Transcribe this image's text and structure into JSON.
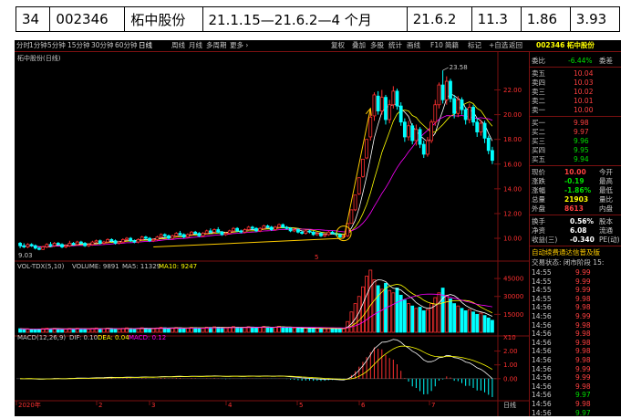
{
  "info_row": [
    "34",
    "002346",
    "柘中股份",
    "21.1.15—21.6.2—4 个月",
    "21.6.2",
    "11.3",
    "1.86",
    "3.93"
  ],
  "toolbar": {
    "periods": [
      "分时",
      "1分钟",
      "5分钟",
      "15分钟",
      "30分钟",
      "60分钟",
      "日线",
      "周线",
      "月线",
      "多周期",
      "更多 ›"
    ],
    "tools": [
      "复权",
      "叠加",
      "多股",
      "统计",
      "画线",
      "F10",
      "简籍",
      "标记",
      "+自选",
      "返回"
    ],
    "stock_code": "002346",
    "stock_name": "柘中股份"
  },
  "price_panel": {
    "label": "柘中股份(日线)",
    "high_label": "23.58",
    "low_label": "9.03",
    "marker": "5",
    "axis_ticks": [
      {
        "v": 22,
        "t": "22.00"
      },
      {
        "v": 20,
        "t": "20.00"
      },
      {
        "v": 18,
        "t": "18.00"
      },
      {
        "v": 16,
        "t": "16.00"
      },
      {
        "v": 14,
        "t": "14.00"
      },
      {
        "v": 12,
        "t": "12.00"
      },
      {
        "v": 10,
        "t": "10.00"
      }
    ]
  },
  "volume_panel": {
    "label": "VOL-TDX(5,10)",
    "vol_label": "VOLUME: 9891",
    "ma5_label": "MA5: 11329",
    "ma10_label": "MA10: 9247",
    "axis_ticks": [
      {
        "v": 45000,
        "t": "45000"
      },
      {
        "v": 30000,
        "t": "30000"
      },
      {
        "v": 15000,
        "t": "15000"
      }
    ],
    "unit": "X10"
  },
  "macd_panel": {
    "label": "MACD(12,26,9)",
    "dif_label": "DIF: 0.10",
    "dea_label": "DEA: 0.04",
    "macd_label": "MACD: 0.12",
    "axis_ticks": [
      {
        "v": 2,
        "t": "2.00"
      },
      {
        "v": 1,
        "t": "1.00"
      },
      {
        "v": 0,
        "t": "0.00"
      }
    ]
  },
  "x_axis": {
    "labels": [
      "2020年",
      "2",
      "3",
      "4",
      "5",
      "6",
      "7"
    ],
    "right_label": "日线"
  },
  "right_panel": {
    "header_code": "002346",
    "header_name": "柘中股份",
    "weibi": {
      "label": "委比",
      "value": "-6.44%",
      "label2": "委差"
    },
    "asks": [
      {
        "label": "卖五",
        "price": "10.04"
      },
      {
        "label": "卖四",
        "price": "10.03"
      },
      {
        "label": "卖三",
        "price": "10.02"
      },
      {
        "label": "卖二",
        "price": "10.01"
      },
      {
        "label": "卖一",
        "price": "10.00"
      }
    ],
    "bids": [
      {
        "label": "买一",
        "price": "9.98"
      },
      {
        "label": "买二",
        "price": "9.97"
      },
      {
        "label": "买三",
        "price": "9.96"
      },
      {
        "label": "买四",
        "price": "9.95"
      },
      {
        "label": "买五",
        "price": "9.94"
      }
    ],
    "quote": [
      {
        "l1": "现价",
        "v": "10.00",
        "l2": "今开",
        "color": "#ff4040"
      },
      {
        "l1": "涨跌",
        "v": "-0.19",
        "l2": "最高",
        "color": "#00e000"
      },
      {
        "l1": "涨幅",
        "v": "-1.86%",
        "l2": "最低",
        "color": "#00e000"
      },
      {
        "l1": "总量",
        "v": "21903",
        "l2": "量比",
        "color": "#ffff00"
      },
      {
        "l1": "外盘",
        "v": "8613",
        "l2": "内盘",
        "color": "#ff4040"
      }
    ],
    "stats": [
      {
        "l1": "换手",
        "v": "0.56%",
        "l2": "股本"
      },
      {
        "l1": "净资",
        "v": "6.08",
        "l2": "流通"
      },
      {
        "l1": "收益(三)",
        "v": "-0.340",
        "l2": "PE(动)"
      }
    ],
    "news": "自动续费通达信普及版",
    "status": "交易状态: 闭市阶段 15:",
    "ticks": [
      {
        "t": "14:55",
        "p": "9.99"
      },
      {
        "t": "14:55",
        "p": "9.99"
      },
      {
        "t": "14:55",
        "p": "9.99"
      },
      {
        "t": "14:55",
        "p": "9.98"
      },
      {
        "t": "14:56",
        "p": "9.98"
      },
      {
        "t": "14:56",
        "p": "9.99"
      },
      {
        "t": "14:56",
        "p": "9.98"
      },
      {
        "t": "14:56",
        "p": "9.98"
      },
      {
        "t": "14:56",
        "p": "9.98"
      },
      {
        "t": "14:56",
        "p": "9.98"
      },
      {
        "t": "14:56",
        "p": "9.98"
      },
      {
        "t": "14:56",
        "p": "9.99"
      },
      {
        "t": "14:56",
        "p": "9.99"
      },
      {
        "t": "14:56",
        "p": "9.98"
      },
      {
        "t": "14:56",
        "p": "9.97"
      },
      {
        "t": "14:56",
        "p": "9.98"
      },
      {
        "t": "14:56",
        "p": "9.97"
      }
    ]
  },
  "colors": {
    "up": "#ff3030",
    "down": "#00ffff",
    "grid": "#7a1010",
    "ma5": "#ffffff",
    "ma10": "#ffff00",
    "ma20": "#ff00ff",
    "axis_text": "#ff3030"
  },
  "chart_data": {
    "type": "candlestick",
    "title": "柘中股份(日线)",
    "ylim": [
      8.6,
      24.4
    ],
    "x_labels": [
      "2020年",
      "2",
      "3",
      "4",
      "5",
      "6",
      "7"
    ],
    "candles": [
      [
        9.6,
        9.4,
        9.7,
        9.2
      ],
      [
        9.4,
        9.3,
        9.6,
        9.2
      ],
      [
        9.3,
        9.5,
        9.6,
        9.2
      ],
      [
        9.5,
        9.4,
        9.6,
        9.3
      ],
      [
        9.4,
        9.2,
        9.5,
        9.1
      ],
      [
        9.2,
        9.1,
        9.3,
        9.03
      ],
      [
        9.1,
        9.3,
        9.4,
        9.05
      ],
      [
        9.3,
        9.5,
        9.6,
        9.2
      ],
      [
        9.5,
        9.4,
        9.7,
        9.3
      ],
      [
        9.4,
        9.6,
        9.7,
        9.3
      ],
      [
        9.6,
        9.5,
        9.7,
        9.4
      ],
      [
        9.5,
        9.3,
        9.6,
        9.2
      ],
      [
        9.3,
        9.4,
        9.5,
        9.2
      ],
      [
        9.4,
        9.6,
        9.8,
        9.3
      ],
      [
        9.6,
        9.5,
        9.7,
        9.4
      ],
      [
        9.5,
        9.7,
        9.8,
        9.4
      ],
      [
        9.7,
        9.6,
        9.8,
        9.5
      ],
      [
        9.6,
        9.4,
        9.7,
        9.3
      ],
      [
        9.4,
        9.5,
        9.6,
        9.3
      ],
      [
        9.5,
        9.7,
        9.8,
        9.4
      ],
      [
        9.7,
        9.8,
        9.9,
        9.6
      ],
      [
        9.8,
        9.6,
        9.9,
        9.5
      ],
      [
        9.6,
        9.7,
        9.8,
        9.5
      ],
      [
        9.7,
        9.9,
        10.0,
        9.6
      ],
      [
        9.9,
        9.8,
        10.0,
        9.7
      ],
      [
        9.8,
        9.6,
        9.9,
        9.5
      ],
      [
        9.6,
        9.7,
        9.8,
        9.5
      ],
      [
        9.7,
        9.9,
        10.0,
        9.6
      ],
      [
        9.9,
        10.0,
        10.1,
        9.8
      ],
      [
        10.0,
        9.8,
        10.1,
        9.7
      ],
      [
        9.8,
        9.7,
        9.9,
        9.6
      ],
      [
        9.7,
        9.9,
        10.0,
        9.6
      ],
      [
        9.9,
        10.1,
        10.2,
        9.8
      ],
      [
        10.1,
        10.0,
        10.2,
        9.9
      ],
      [
        10.0,
        9.8,
        10.1,
        9.7
      ],
      [
        9.8,
        9.9,
        10.0,
        9.7
      ],
      [
        9.9,
        10.1,
        10.2,
        9.8
      ],
      [
        10.1,
        10.3,
        10.4,
        10.0
      ],
      [
        10.3,
        10.2,
        10.4,
        10.1
      ],
      [
        10.2,
        10.0,
        10.3,
        9.9
      ],
      [
        10.0,
        10.2,
        10.3,
        9.9
      ],
      [
        10.2,
        10.4,
        10.5,
        10.1
      ],
      [
        10.4,
        10.3,
        10.6,
        10.2
      ],
      [
        10.3,
        10.1,
        10.4,
        10.0
      ],
      [
        10.1,
        10.3,
        10.4,
        10.0
      ],
      [
        10.3,
        10.5,
        10.6,
        10.2
      ],
      [
        10.5,
        10.4,
        10.6,
        10.3
      ],
      [
        10.4,
        10.2,
        10.5,
        10.1
      ],
      [
        10.2,
        10.4,
        10.5,
        10.1
      ],
      [
        10.4,
        10.6,
        10.7,
        10.3
      ],
      [
        10.6,
        10.5,
        10.8,
        10.4
      ],
      [
        10.5,
        10.7,
        10.8,
        10.4
      ],
      [
        10.7,
        10.5,
        10.9,
        10.4
      ],
      [
        10.5,
        10.3,
        10.6,
        10.2
      ],
      [
        10.3,
        10.4,
        10.5,
        10.2
      ],
      [
        10.4,
        10.6,
        10.7,
        10.3
      ],
      [
        10.6,
        10.8,
        10.9,
        10.5
      ],
      [
        10.8,
        10.6,
        10.9,
        10.5
      ],
      [
        10.6,
        10.5,
        10.7,
        10.4
      ],
      [
        10.5,
        10.7,
        10.8,
        10.4
      ],
      [
        10.7,
        10.9,
        11.0,
        10.6
      ],
      [
        10.9,
        10.8,
        11.0,
        10.7
      ],
      [
        10.8,
        10.6,
        10.9,
        10.5
      ],
      [
        10.6,
        10.8,
        10.9,
        10.5
      ],
      [
        10.8,
        11.0,
        11.1,
        10.7
      ],
      [
        11.0,
        10.9,
        11.1,
        10.8
      ],
      [
        10.9,
        10.7,
        11.0,
        10.6
      ],
      [
        10.7,
        10.9,
        11.0,
        10.6
      ],
      [
        10.9,
        11.1,
        11.2,
        10.8
      ],
      [
        11.1,
        10.9,
        11.2,
        10.8
      ],
      [
        10.9,
        10.8,
        11.0,
        10.7
      ],
      [
        10.8,
        10.6,
        10.9,
        10.5
      ],
      [
        10.6,
        10.7,
        10.8,
        10.5
      ],
      [
        10.7,
        10.5,
        10.8,
        10.4
      ],
      [
        10.5,
        10.4,
        10.6,
        10.3
      ],
      [
        10.4,
        10.6,
        10.7,
        10.3
      ],
      [
        10.6,
        10.5,
        10.7,
        10.4
      ],
      [
        10.5,
        10.3,
        10.6,
        10.2
      ],
      [
        10.3,
        10.4,
        10.5,
        10.2
      ],
      [
        10.4,
        10.2,
        10.5,
        10.1
      ],
      [
        10.2,
        10.3,
        10.4,
        10.1
      ],
      [
        10.3,
        10.5,
        10.6,
        10.2
      ],
      [
        10.5,
        10.4,
        10.6,
        10.3
      ],
      [
        10.4,
        10.3,
        10.5,
        10.2
      ],
      [
        10.3,
        10.1,
        10.4,
        10.0
      ],
      [
        10.1,
        10.2,
        10.3,
        10.0
      ],
      [
        10.2,
        11.2,
        11.2,
        10.1
      ],
      [
        11.2,
        12.3,
        12.3,
        11.2
      ],
      [
        12.3,
        13.5,
        13.5,
        12.2
      ],
      [
        13.6,
        14.9,
        14.9,
        13.5
      ],
      [
        15.0,
        16.4,
        16.4,
        14.9
      ],
      [
        16.5,
        18.0,
        18.0,
        16.4
      ],
      [
        18.2,
        19.8,
        20.4,
        17.9
      ],
      [
        19.9,
        21.6,
        21.8,
        19.5
      ],
      [
        21.5,
        20.3,
        21.9,
        20.0
      ],
      [
        20.3,
        21.4,
        22.0,
        20.0
      ],
      [
        21.4,
        19.6,
        21.6,
        19.2
      ],
      [
        19.6,
        20.8,
        21.2,
        19.3
      ],
      [
        20.8,
        21.9,
        22.3,
        20.5
      ],
      [
        21.9,
        20.7,
        22.1,
        20.4
      ],
      [
        20.7,
        19.4,
        21.0,
        19.1
      ],
      [
        19.4,
        18.2,
        19.7,
        17.8
      ],
      [
        18.2,
        19.1,
        19.5,
        17.9
      ],
      [
        19.1,
        17.9,
        19.3,
        17.6
      ],
      [
        17.9,
        18.8,
        19.2,
        17.5
      ],
      [
        18.8,
        17.6,
        19.0,
        17.3
      ],
      [
        17.6,
        16.8,
        17.9,
        16.5
      ],
      [
        16.8,
        17.9,
        18.2,
        16.6
      ],
      [
        17.9,
        19.4,
        19.6,
        17.7
      ],
      [
        19.4,
        20.8,
        21.2,
        19.1
      ],
      [
        20.8,
        22.4,
        22.6,
        20.5
      ],
      [
        22.4,
        21.2,
        23.58,
        20.9
      ],
      [
        21.2,
        22.7,
        23.1,
        20.8
      ],
      [
        22.7,
        21.3,
        22.9,
        21.0
      ],
      [
        21.3,
        20.1,
        21.6,
        19.7
      ],
      [
        20.1,
        21.2,
        21.5,
        19.8
      ],
      [
        21.2,
        20.4,
        21.4,
        20.0
      ],
      [
        20.4,
        19.6,
        20.6,
        19.2
      ],
      [
        19.6,
        20.6,
        20.9,
        19.3
      ],
      [
        20.6,
        19.4,
        20.8,
        19.1
      ],
      [
        19.4,
        18.6,
        19.7,
        18.2
      ],
      [
        18.6,
        19.3,
        19.6,
        18.3
      ],
      [
        19.3,
        18.1,
        19.5,
        17.7
      ],
      [
        18.1,
        17.1,
        18.3,
        16.8
      ],
      [
        17.1,
        16.3,
        17.4,
        16.0
      ]
    ],
    "volume": [
      3000,
      2600,
      2800,
      2400,
      2200,
      2700,
      3100,
      3500,
      2900,
      3300,
      2800,
      2500,
      2700,
      3200,
      2900,
      3400,
      3000,
      2600,
      2800,
      3300,
      3600,
      3100,
      2900,
      3400,
      3200,
      2800,
      2700,
      3300,
      3700,
      3200,
      2900,
      3200,
      3800,
      3500,
      3000,
      3100,
      3600,
      4200,
      3800,
      3300,
      3500,
      4000,
      3800,
      3300,
      3500,
      4100,
      3900,
      3400,
      3500,
      4300,
      4100,
      4600,
      4300,
      3700,
      3600,
      4200,
      4800,
      4300,
      3800,
      4100,
      4700,
      4400,
      3900,
      4200,
      4900,
      4500,
      4000,
      4300,
      5000,
      4600,
      4000,
      3800,
      3600,
      3500,
      3300,
      3500,
      3400,
      3200,
      3300,
      3100,
      3200,
      3400,
      3300,
      3200,
      3000,
      3100,
      9000,
      17000,
      24000,
      30000,
      38000,
      47000,
      52000,
      44000,
      39000,
      36000,
      41000,
      35000,
      33000,
      37000,
      31000,
      27000,
      24000,
      22000,
      20000,
      21000,
      18000,
      19000,
      24000,
      29000,
      33000,
      37000,
      31000,
      28000,
      24000,
      22000,
      20000,
      18000,
      19000,
      17000,
      15000,
      16000,
      14000,
      12000,
      10000
    ],
    "vol_ylim": [
      0,
      55000
    ],
    "macd_ylim": [
      -1.4,
      2.7
    ]
  }
}
